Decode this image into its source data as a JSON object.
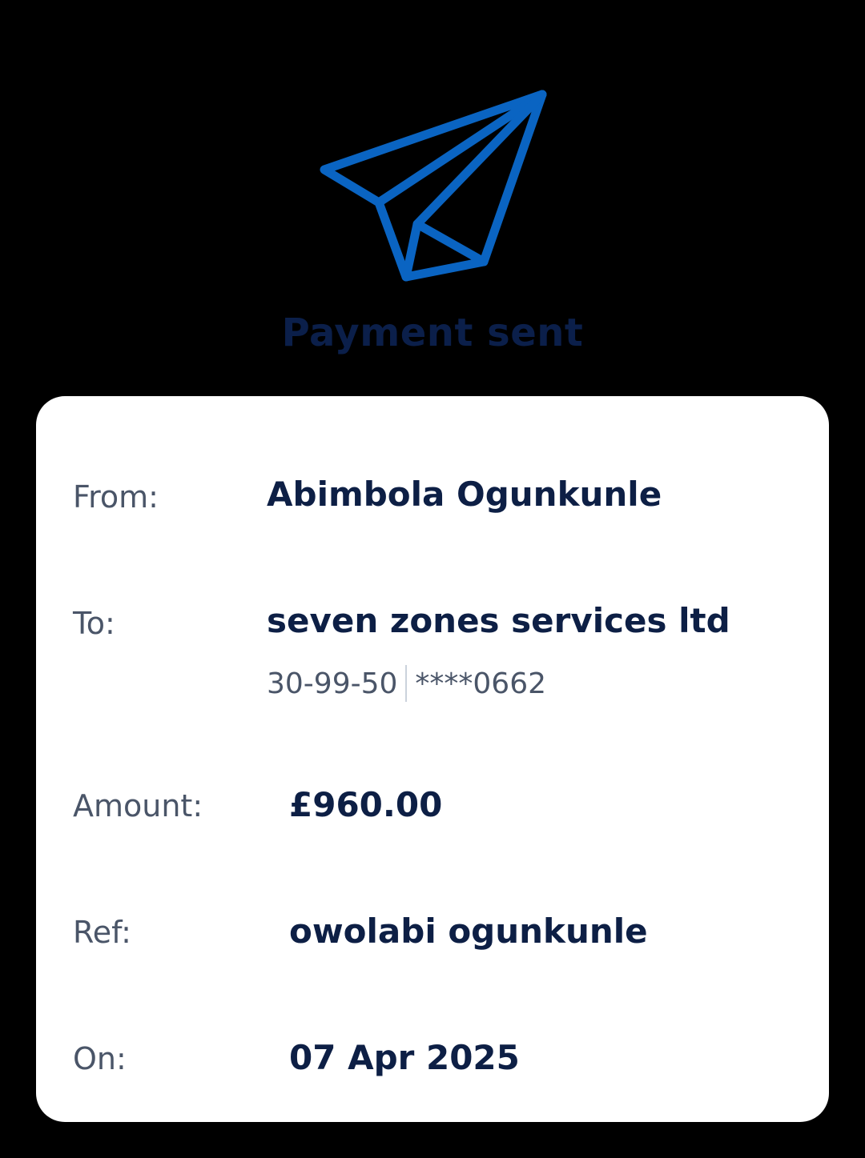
{
  "header": {
    "icon": "paper-plane-icon",
    "title": "Payment sent"
  },
  "details": {
    "from_label": "From:",
    "from_value": "Abimbola Ogunkunle",
    "to_label": "To:",
    "to_value": "seven zones services ltd",
    "sort_code": "30-99-50",
    "account_number": "****0662",
    "amount_label": "Amount:",
    "amount_value": "£960.00",
    "ref_label": "Ref:",
    "ref_value": "owolabi ogunkunle",
    "on_label": "On:",
    "on_value": "07 Apr 2025"
  },
  "colors": {
    "background": "#000000",
    "card": "#ffffff",
    "accent": "#0a64c2",
    "title": "#0b1f4a",
    "value_text": "#0d1f45",
    "label_text": "#4a5568"
  }
}
